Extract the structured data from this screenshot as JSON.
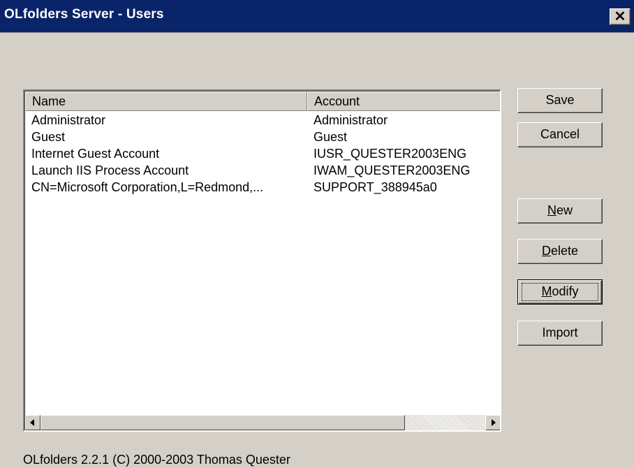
{
  "window": {
    "title": "OLfolders Server - Users",
    "close_glyph": "✕"
  },
  "list": {
    "columns": [
      "Name",
      "Account"
    ],
    "rows": [
      {
        "name": "Administrator",
        "account": "Administrator"
      },
      {
        "name": "Guest",
        "account": "Guest"
      },
      {
        "name": "Internet Guest Account",
        "account": "IUSR_QUESTER2003ENG"
      },
      {
        "name": "Launch IIS Process Account",
        "account": "IWAM_QUESTER2003ENG"
      },
      {
        "name": "CN=Microsoft Corporation,L=Redmond,...",
        "account": "SUPPORT_388945a0"
      }
    ]
  },
  "buttons": {
    "save": "Save",
    "cancel": "Cancel",
    "new_first": "N",
    "new_rest": "ew",
    "delete_first": "D",
    "delete_rest": "elete",
    "modify_first": "M",
    "modify_rest": "odify",
    "import": "Import"
  },
  "footer": {
    "text": "OLfolders 2.2.1 (C) 2000-2003 Thomas Quester"
  },
  "colors": {
    "titlebar": "#0a246a",
    "face": "#d4d0c8"
  },
  "icons": {
    "close": "close-icon",
    "scroll_left": "arrow-left-icon",
    "scroll_right": "arrow-right-icon"
  }
}
